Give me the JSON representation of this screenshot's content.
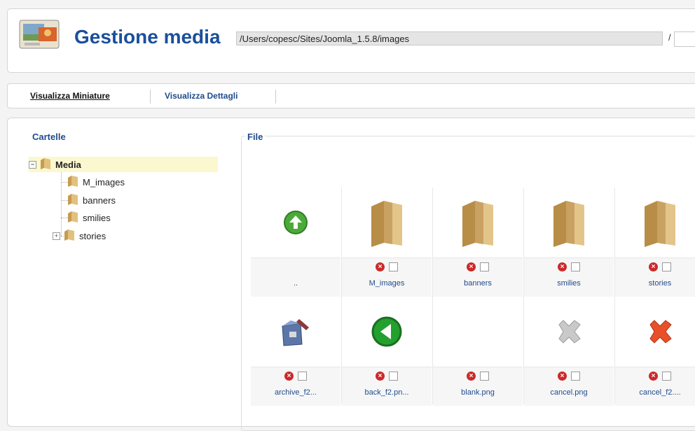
{
  "header": {
    "title": "Gestione media",
    "logo_icon": "media-manager-icon"
  },
  "tabs": [
    {
      "label": "Visualizza Miniature",
      "active": true
    },
    {
      "label": "Visualizza Dettagli",
      "active": false
    }
  ],
  "folders_panel": {
    "legend": "Cartelle",
    "tree": [
      {
        "label": "Media",
        "expanded": true
      },
      {
        "label": "M_images"
      },
      {
        "label": "banners"
      },
      {
        "label": "smilies"
      },
      {
        "label": "stories",
        "expandable": true
      }
    ]
  },
  "files_panel": {
    "legend": "File",
    "path": "/Users/copesc/Sites/Joomla_1.5.8/images",
    "path_separator": "/",
    "items": [
      {
        "name": "..",
        "icon": "up-arrow-icon"
      },
      {
        "name": "M_images",
        "icon": "folder-icon"
      },
      {
        "name": "banners",
        "icon": "folder-icon"
      },
      {
        "name": "smilies",
        "icon": "folder-icon"
      },
      {
        "name": "stories",
        "icon": "folder-icon"
      },
      {
        "name": "archive_f2...",
        "icon": "archive-icon"
      },
      {
        "name": "back_f2.pn...",
        "icon": "back-arrow-icon"
      },
      {
        "name": "blank.png",
        "icon": "blank-icon"
      },
      {
        "name": "cancel.png",
        "icon": "cancel-gray-icon"
      },
      {
        "name": "cancel_f2....",
        "icon": "cancel-red-icon"
      }
    ]
  },
  "colors": {
    "title": "#1a4f9c",
    "link": "#1f4b8e",
    "tree_highlight": "#fbf7cf"
  }
}
